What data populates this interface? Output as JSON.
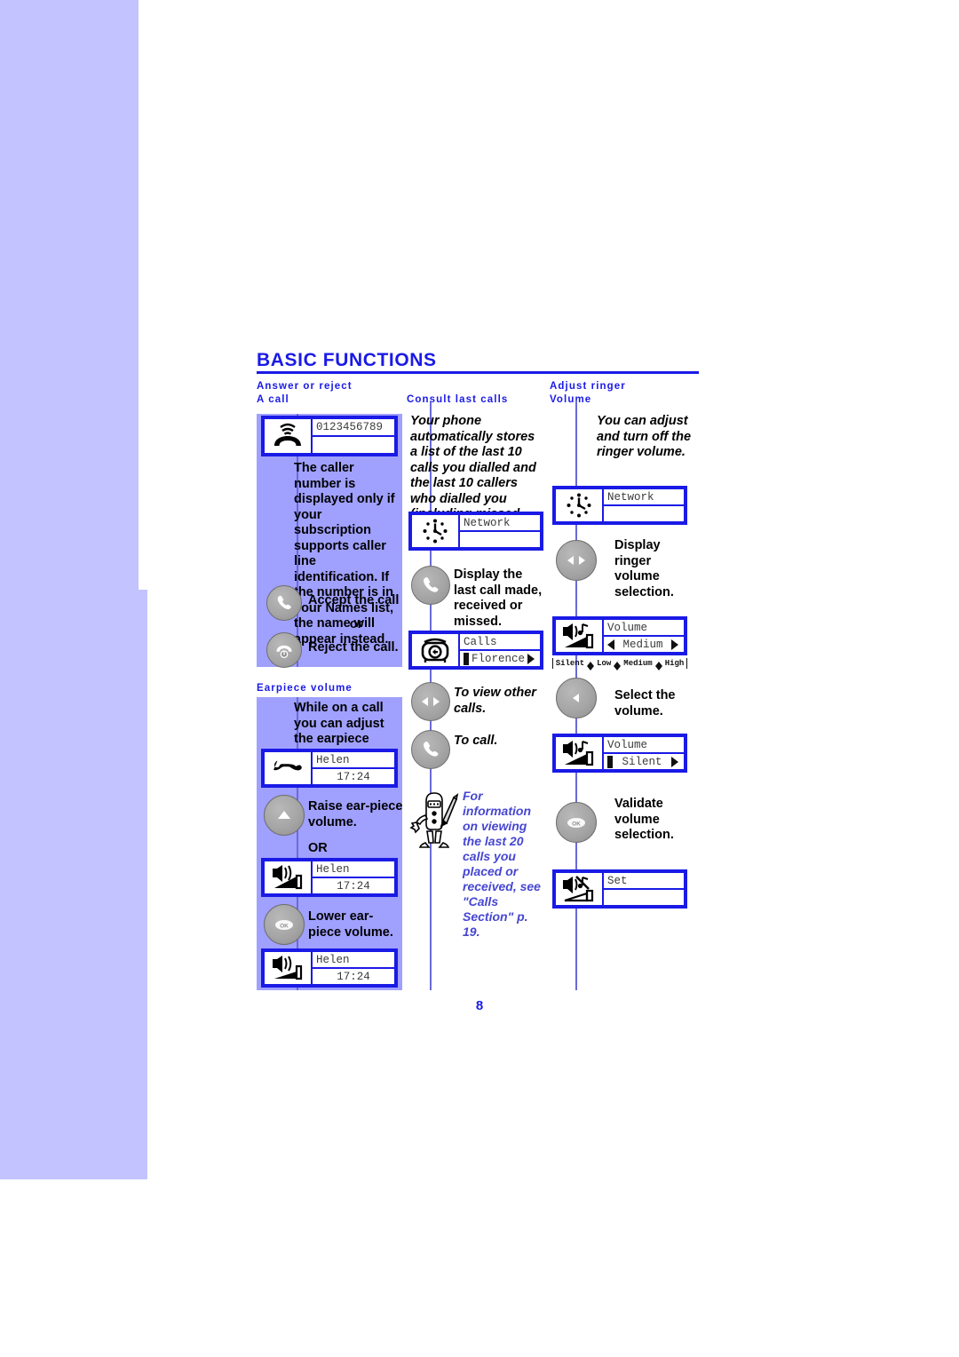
{
  "document": {
    "title": "Basic functions",
    "page_number": "8"
  },
  "sections": {
    "answer_reject": {
      "heading_line1": "Answer or reject",
      "heading_line2": "A call",
      "screen": {
        "icon": "ringing-phone-icon",
        "line1": "0123456789",
        "line2": ""
      },
      "body": "The caller number is displayed only if your subscription supports caller line identification. If the number is in your Names list, the name will appear instead.",
      "steps": [
        {
          "key_icon": "phone-handset-icon",
          "label": "Accept the call"
        },
        {
          "key_icon": "",
          "label": "or"
        },
        {
          "key_icon": "phone-hangup-icon",
          "label": "Reject the call."
        }
      ]
    },
    "earpiece_volume": {
      "heading": "Earpiece volume",
      "intro": "While on a call you can adjust the earpiece volume.",
      "screen1": {
        "icon": "phone-handset-icon",
        "line1": "Helen",
        "line2": "17:24"
      },
      "step_up": {
        "key_icon": "up-arrow-icon",
        "label": "Raise ear-piece volume."
      },
      "or_label": "OR",
      "screen2": {
        "icon": "speaker-volume-high-icon",
        "line1": "Helen",
        "line2": "17:24"
      },
      "step_down": {
        "key_icon": "ok-key-icon",
        "label": "Lower ear-piece volume."
      },
      "screen3": {
        "icon": "speaker-volume-low-icon",
        "line1": "Helen",
        "line2": "17:24"
      }
    },
    "consult_last_calls": {
      "heading": "Consult last calls",
      "intro": "Your phone automatically stores a list of the last 10 calls you dialled and the last 10 callers who dialled you (including missed calls).",
      "screen1": {
        "icon": "clock-icon",
        "line1": "Network",
        "line2": ""
      },
      "step1": {
        "key_icon": "phone-handset-icon",
        "label": "Display the last call made, received or missed."
      },
      "screen2": {
        "icon": "calls-phone-icon",
        "line1": "Calls",
        "line2": "Florence",
        "marker": "bar",
        "arrow_right": true
      },
      "step2": {
        "key_icon": "left-right-arrows-icon",
        "label": "To view other calls."
      },
      "step3": {
        "key_icon": "phone-handset-icon",
        "label": "To call."
      },
      "tip": {
        "icon": "mascot-pencil-icon",
        "text": "For information on viewing the last 20 calls you placed or received, see \"Calls Section\" p. 19."
      }
    },
    "adjust_ringer_volume": {
      "heading_line1": "Adjust ringer",
      "heading_line2": "Volume",
      "intro": "You can adjust and turn off the ringer volume.",
      "screen1": {
        "icon": "clock-icon",
        "line1": "Network",
        "line2": ""
      },
      "step1": {
        "key_icon": "left-right-arrows-icon",
        "label": "Display ringer volume selection."
      },
      "screen2": {
        "icon": "ringer-volume-icon",
        "line1": "Volume",
        "line2": "Medium",
        "arrow_left": true,
        "arrow_right": true
      },
      "scale": {
        "labels": [
          "Silent",
          "Low",
          "Medium",
          "High"
        ]
      },
      "step2": {
        "key_icon": "left-arrow-icon",
        "label": "Select the volume."
      },
      "screen3": {
        "icon": "ringer-volume-icon",
        "line1": "Volume",
        "line2": "Silent",
        "marker": "bar",
        "arrow_right": true
      },
      "step3": {
        "key_icon": "ok-key-icon",
        "label": "Validate volume selection."
      },
      "screen4": {
        "icon": "ringer-muted-icon",
        "line1": "Set",
        "line2": ""
      }
    }
  },
  "colors": {
    "accent_blue": "#1a1ae6",
    "panel_dark": "#a0a0ff",
    "panel_light": "#c3c3ff",
    "spine": "#6a6ad8",
    "key_gray": "#a5a5a5",
    "tip_blue": "#4646d2"
  }
}
